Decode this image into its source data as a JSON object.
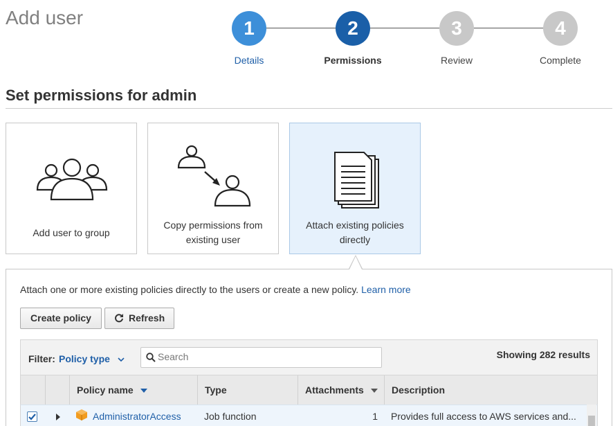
{
  "header": {
    "title": "Add user"
  },
  "steps": [
    {
      "number": "1",
      "label": "Details",
      "state": "done"
    },
    {
      "number": "2",
      "label": "Permissions",
      "state": "current"
    },
    {
      "number": "3",
      "label": "Review",
      "state": "pending"
    },
    {
      "number": "4",
      "label": "Complete",
      "state": "pending"
    }
  ],
  "colors": {
    "step_done": "#3d8fd9",
    "step_current": "#1a5fa8",
    "step_pending": "#c8c8c8",
    "link": "#1f5fa8",
    "selected_card_bg": "#e6f1fc"
  },
  "section": {
    "title": "Set permissions for admin"
  },
  "options": [
    {
      "label": "Add user to group",
      "icon": "user-group-icon",
      "selected": false
    },
    {
      "label": "Copy permissions from existing user",
      "icon": "copy-user-icon",
      "selected": false
    },
    {
      "label": "Attach existing policies directly",
      "icon": "document-stack-icon",
      "selected": true
    }
  ],
  "panel": {
    "intro": "Attach one or more existing policies directly to the users or create a new policy.",
    "learn_more": "Learn more",
    "create_policy": "Create policy",
    "refresh": "Refresh"
  },
  "filter": {
    "label": "Filter:",
    "value": "Policy type",
    "search_placeholder": "Search",
    "results": "Showing 282 results"
  },
  "table": {
    "columns": [
      "Policy name",
      "Type",
      "Attachments",
      "Description"
    ],
    "rows": [
      {
        "checked": true,
        "name": "AdministratorAccess",
        "type": "Job function",
        "attachments": "1",
        "description": "Provides full access to AWS services and..."
      }
    ]
  }
}
